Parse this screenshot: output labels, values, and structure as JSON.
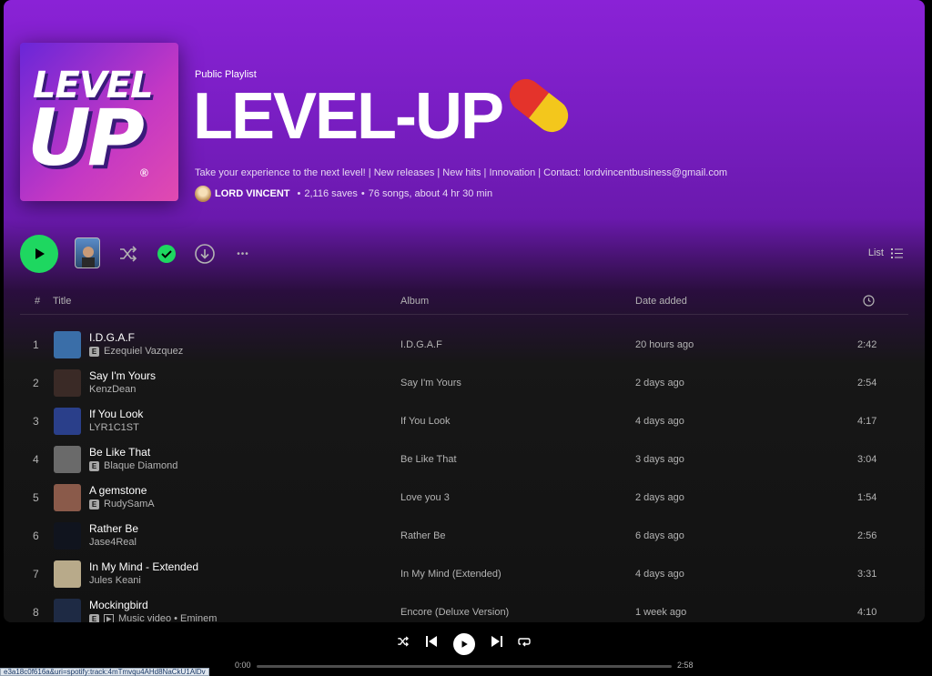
{
  "playlist": {
    "type_label": "Public Playlist",
    "title": "LEVEL-UP",
    "cover_text_top": "LEVEL",
    "cover_text_bottom": "UP",
    "cover_mark": "®",
    "description": "Take your experience to the next level! | New releases | New hits | Innovation | Contact: lordvincentbusiness@gmail.com",
    "owner": "LORD VINCENT",
    "saves": "2,116 saves",
    "summary": "76 songs, about 4 hr 30 min",
    "sep": "•",
    "pill_icon": "pill-emoji-icon"
  },
  "controls": {
    "view_label": "List",
    "more_glyph": "•••"
  },
  "table": {
    "headers": {
      "num": "#",
      "title": "Title",
      "album": "Album",
      "date": "Date added"
    },
    "rows": [
      {
        "num": "1",
        "title": "I.D.G.A.F",
        "explicit": true,
        "video": false,
        "artist": "Ezequiel Vazquez",
        "album": "I.D.G.A.F",
        "date": "20 hours ago",
        "duration": "2:42",
        "art": "#3a6ea8"
      },
      {
        "num": "2",
        "title": "Say I'm Yours",
        "explicit": false,
        "video": false,
        "artist": "KenzDean",
        "album": "Say I'm Yours",
        "date": "2 days ago",
        "duration": "2:54",
        "art": "#3a2a26"
      },
      {
        "num": "3",
        "title": "If You Look",
        "explicit": false,
        "video": false,
        "artist": "LYR1C1ST",
        "album": "If You Look",
        "date": "4 days ago",
        "duration": "4:17",
        "art": "#2a3f8a"
      },
      {
        "num": "4",
        "title": "Be Like That",
        "explicit": true,
        "video": false,
        "artist": "Blaque Diamond",
        "album": "Be Like That",
        "date": "3 days ago",
        "duration": "3:04",
        "art": "#6a6a6a"
      },
      {
        "num": "5",
        "title": "A gemstone",
        "explicit": true,
        "video": false,
        "artist": "RudySamA",
        "album": "Love you 3",
        "date": "2 days ago",
        "duration": "1:54",
        "art": "#8a5a4a"
      },
      {
        "num": "6",
        "title": "Rather Be",
        "explicit": false,
        "video": false,
        "artist": "Jase4Real",
        "album": "Rather Be",
        "date": "6 days ago",
        "duration": "2:56",
        "art": "#10141e"
      },
      {
        "num": "7",
        "title": "In My Mind - Extended",
        "explicit": false,
        "video": false,
        "artist": "Jules Keani",
        "album": "In My Mind (Extended)",
        "date": "4 days ago",
        "duration": "3:31",
        "art": "#b8aa8a"
      },
      {
        "num": "8",
        "title": "Mockingbird",
        "explicit": true,
        "video": true,
        "artist": "Music video • Eminem",
        "album": "Encore (Deluxe Version)",
        "date": "1 week ago",
        "duration": "4:10",
        "art": "#1e2a44"
      }
    ]
  },
  "player": {
    "current_time": "0:00",
    "total_time": "2:58",
    "progress": 0
  },
  "status_bar": {
    "url_text": "e3a18c0f616a&uri=spotify:track:4mTmvqu4AHd8NaCkU1AlDv"
  },
  "colors": {
    "accent": "#1ed760",
    "header_gradient_top": "#8a22d6",
    "background": "#121212"
  }
}
